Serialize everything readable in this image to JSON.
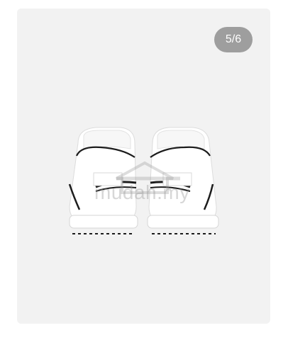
{
  "gallery": {
    "counter_text": "5/6",
    "image_icon": "sneaker-back-view",
    "watermark_text": "mudah.my",
    "background_color": "#f2f2f2",
    "counter_color": "#9e9e9e"
  }
}
